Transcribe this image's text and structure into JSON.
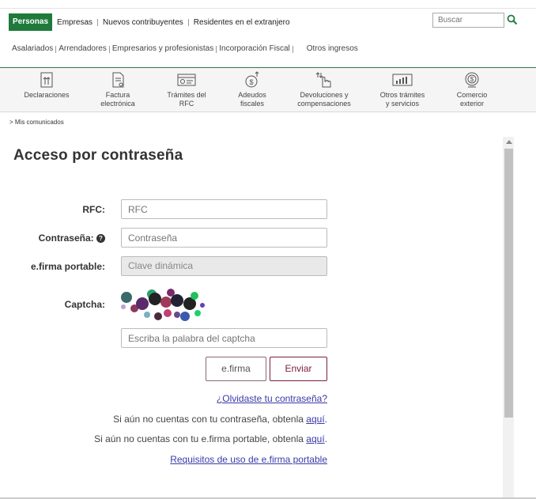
{
  "top_nav": {
    "items": [
      "Personas",
      "Empresas",
      "Nuevos contribuyentes",
      "Residentes en el extranjero"
    ],
    "search_placeholder": "Buscar"
  },
  "sub_nav": {
    "items": [
      "Asalariados",
      "Arrendadores",
      "Empresarios y profesionistas",
      "Incorporación Fiscal",
      "Otros ingresos"
    ]
  },
  "icon_bar": {
    "items": [
      {
        "line1": "Declaraciones",
        "line2": "",
        "icon": "documents-arrows-icon"
      },
      {
        "line1": "Factura",
        "line2": "electrónica",
        "icon": "invoice-icon"
      },
      {
        "line1": "Trámites del",
        "line2": "RFC",
        "icon": "rfc-card-icon"
      },
      {
        "line1": "Adeudos",
        "line2": "fiscales",
        "icon": "debts-icon"
      },
      {
        "line1": "Devoluciones y",
        "line2": "compensaciones",
        "icon": "hand-touch-icon"
      },
      {
        "line1": "Otros trámites",
        "line2": "y servicios",
        "icon": "chart-board-icon"
      },
      {
        "line1": "Comercio",
        "line2": "exterior",
        "icon": "globe-dollar-icon"
      }
    ]
  },
  "breadcrumb": "> Mis comunicados",
  "form": {
    "title": "Acceso por contraseña",
    "rfc_label": "RFC:",
    "rfc_placeholder": "RFC",
    "password_label": "Contraseña:",
    "password_placeholder": "Contraseña",
    "efirma_label": "e.firma portable:",
    "efirma_placeholder": "Clave dinámica",
    "captcha_label": "Captcha:",
    "captcha_placeholder": "Escriba la palabra del captcha",
    "efirma_button": "e.firma",
    "submit_button": "Enviar",
    "forgot_link": "¿Olvidaste tu contraseña?",
    "no_password_text": "Si aún no cuentas con tu contraseña, obtenla",
    "no_efirma_text": "Si aún no cuentas con tu e.firma portable, obtenla",
    "here_link": "aquí",
    "requirements_link": "Requisitos de uso de e.firma portable"
  },
  "colors": {
    "brand_green": "#1f7a3c",
    "button_wine": "#7a2040",
    "link_blue": "#3a3aa8"
  }
}
